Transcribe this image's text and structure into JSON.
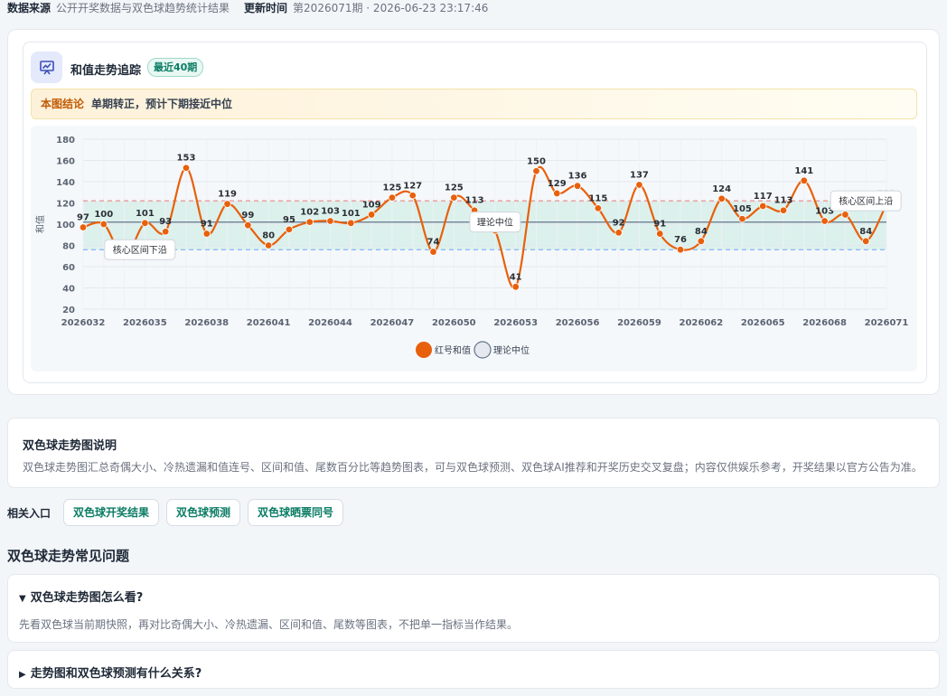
{
  "meta": {
    "source_label": "数据来源",
    "source_value": "公开开奖数据与双色球趋势统计结果",
    "update_label": "更新时间",
    "update_value": "第2026071期 · 2026-06-23 23:17:46"
  },
  "panel": {
    "icon": "chart-trend-icon",
    "title": "和值走势追踪",
    "badge": "最近40期",
    "conclusion_label": "本图结论",
    "conclusion_text": "单期转正，预计下期接近中位"
  },
  "chart_data": {
    "type": "line",
    "ylabel": "和值",
    "ylim": [
      20,
      180
    ],
    "yticks": [
      20,
      40,
      60,
      80,
      100,
      120,
      140,
      160,
      180
    ],
    "xticks": [
      "2026032",
      "2026035",
      "2026038",
      "2026041",
      "2026044",
      "2026047",
      "2026050",
      "2026053",
      "2026056",
      "2026059",
      "2026062",
      "2026065",
      "2026068",
      "2026071"
    ],
    "x": [
      "2026032",
      "2026033",
      "2026034",
      "2026035",
      "2026036",
      "2026037",
      "2026038",
      "2026039",
      "2026040",
      "2026041",
      "2026042",
      "2026043",
      "2026044",
      "2026045",
      "2026046",
      "2026047",
      "2026048",
      "2026049",
      "2026050",
      "2026051",
      "2026052",
      "2026053",
      "2026054",
      "2026055",
      "2026056",
      "2026057",
      "2026058",
      "2026059",
      "2026060",
      "2026061",
      "2026062",
      "2026063",
      "2026064",
      "2026065",
      "2026066",
      "2026067",
      "2026068",
      "2026069",
      "2026070",
      "2026071"
    ],
    "series": [
      {
        "name": "红号和值",
        "color": "#e8600c",
        "values": [
          97,
          100,
          69,
          101,
          93,
          153,
          91,
          119,
          99,
          80,
          95,
          102,
          103,
          101,
          109,
          125,
          127,
          74,
          125,
          113,
          94,
          41,
          150,
          129,
          136,
          115,
          92,
          137,
          91,
          76,
          84,
          124,
          105,
          117,
          113,
          141,
          103,
          109,
          84,
          119
        ]
      }
    ],
    "reference_lines": [
      {
        "name": "理论中位",
        "value": 102,
        "label": "理论中位",
        "color": "#64748b"
      },
      {
        "name": "核心区间上沿",
        "value": 122,
        "label": "核心区间上沿",
        "color": "#ef4444"
      },
      {
        "name": "核心区间下沿",
        "value": 76,
        "label": "核心区间下沿",
        "color": "#3b82f6"
      }
    ],
    "band": [
      76,
      122
    ],
    "band_color": "#dcf1ec",
    "legend": [
      "红号和值",
      "理论中位"
    ],
    "legend_position": "bottom",
    "grid": true
  },
  "description": {
    "title": "双色球走势图说明",
    "text": "双色球走势图汇总奇偶大小、冷热遗漏和值连号、区间和值、尾数百分比等趋势图表，可与双色球预测、双色球AI推荐和开奖历史交叉复盘；内容仅供娱乐参考，开奖结果以官方公告为准。"
  },
  "related": {
    "label": "相关入口",
    "links": [
      "双色球开奖结果",
      "双色球预测",
      "双色球晒票同号"
    ]
  },
  "faq": {
    "title": "双色球走势常见问题",
    "items": [
      {
        "q": "双色球走势图怎么看?",
        "a": "先看双色球当前期快照，再对比奇偶大小、冷热遗漏、区间和值、尾数等图表，不把单一指标当作结果。",
        "open": true
      },
      {
        "q": "走势图和双色球预测有什么关系?",
        "a": "",
        "open": false
      }
    ]
  }
}
